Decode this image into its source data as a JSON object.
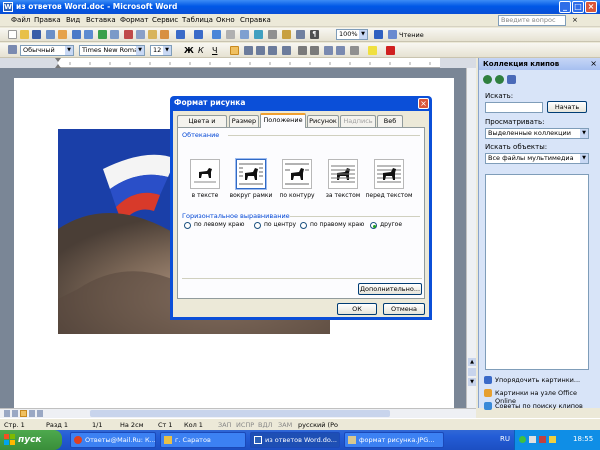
{
  "window": {
    "title": "из ответов Word.doc - Microsoft Word"
  },
  "menu": {
    "items": [
      "Файл",
      "Правка",
      "Вид",
      "Вставка",
      "Формат",
      "Сервис",
      "Таблица",
      "Окно",
      "Справка"
    ],
    "ask_placeholder": "Введите вопрос"
  },
  "toolbar": {
    "zoom": "100%",
    "read_label": "Чтение"
  },
  "format_toolbar": {
    "style": "Обычный",
    "font": "Times New Roman",
    "size": "12",
    "bold": "Ж",
    "italic": "К",
    "underline": "Ч"
  },
  "dialog": {
    "title": "Формат рисунка",
    "tabs": [
      {
        "label": "Цвета и линии",
        "state": "normal"
      },
      {
        "label": "Размер",
        "state": "normal"
      },
      {
        "label": "Положение",
        "state": "active"
      },
      {
        "label": "Рисунок",
        "state": "normal"
      },
      {
        "label": "Надпись",
        "state": "disabled"
      },
      {
        "label": "Веб",
        "state": "normal"
      }
    ],
    "wrap_group": "Обтекание",
    "wrap_options": [
      "в тексте",
      "вокруг рамки",
      "по контуру",
      "за текстом",
      "перед текстом"
    ],
    "wrap_selected": 1,
    "align_group": "Горизонтальное выравнивание",
    "align_options": [
      "по левому краю",
      "по центру",
      "по правому краю",
      "другое"
    ],
    "align_selected": 3,
    "advanced_label": "Дополнительно...",
    "ok_label": "ОК",
    "cancel_label": "Отмена"
  },
  "task_pane": {
    "title": "Коллекция клипов",
    "search_label": "Искать:",
    "search_button": "Начать",
    "browse_label": "Просматривать:",
    "browse_value": "Выделенные коллекции",
    "objects_label": "Искать объекты:",
    "objects_value": "Все файлы мультимедиа",
    "links": [
      "Упорядочить картинки...",
      "Картинки на узле Office Online",
      "Советы по поиску клипов"
    ]
  },
  "status_bar": {
    "page": "Стр. 1",
    "section": "Разд 1",
    "pages": "1/1",
    "at": "На 2см",
    "line": "Ст 1",
    "col": "Кол 1",
    "rec": "ЗАП",
    "trk": "ИСПР",
    "ext": "ВДЛ",
    "ovr": "ЗАМ",
    "lang": "русский (Ро"
  },
  "taskbar": {
    "start_label": "пуск",
    "tasks": [
      "Ответы@Mail.Ru: К...",
      "г. Саратов",
      "из ответов Word.do...",
      "формат рисунка.JPG..."
    ],
    "active_task": 2,
    "lang": "RU",
    "clock": "18:55"
  },
  "colors": {
    "xp_blue": "#0058e6",
    "start_green": "#3a8e3a",
    "close_red": "#d9573a"
  }
}
